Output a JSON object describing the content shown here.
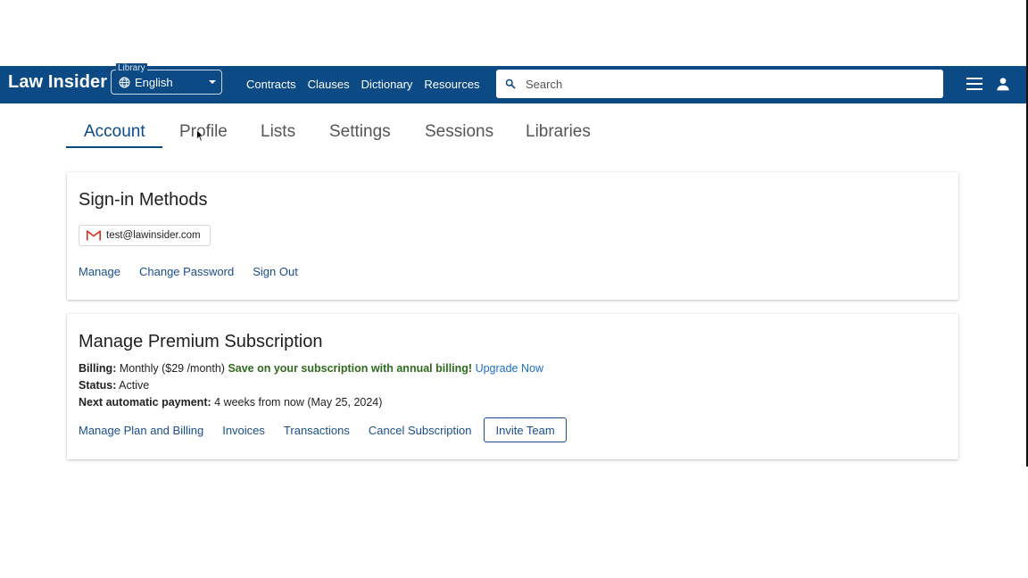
{
  "header": {
    "brand": "Law Insider",
    "library": {
      "label": "Library",
      "value": "English"
    },
    "nav": [
      "Contracts",
      "Clauses",
      "Dictionary",
      "Resources"
    ],
    "search_placeholder": "Search"
  },
  "tabs": [
    {
      "label": "Account",
      "active": true
    },
    {
      "label": "Profile",
      "active": false
    },
    {
      "label": "Lists",
      "active": false
    },
    {
      "label": "Settings",
      "active": false
    },
    {
      "label": "Sessions",
      "active": false
    },
    {
      "label": "Libraries",
      "active": false
    }
  ],
  "signin": {
    "title": "Sign-in Methods",
    "email": "test@lawinsider.com",
    "links": [
      "Manage",
      "Change Password",
      "Sign Out"
    ]
  },
  "subscription": {
    "title": "Manage Premium Subscription",
    "billing_label": "Billing:",
    "billing_value": "Monthly ($29 /month)",
    "promo": "Save on your subscription with annual billing!",
    "upgrade": "Upgrade Now",
    "status_label": "Status:",
    "status_value": "Active",
    "payment_label": "Next automatic payment:",
    "payment_value": "4 weeks from now (May 25, 2024)",
    "actions": [
      "Manage Plan and Billing",
      "Invoices",
      "Transactions",
      "Cancel Subscription"
    ],
    "invite_button": "Invite Team"
  },
  "colors": {
    "header_bg": "#0c4a86",
    "link": "#1a4f8c",
    "promo": "#2e6b1d"
  }
}
